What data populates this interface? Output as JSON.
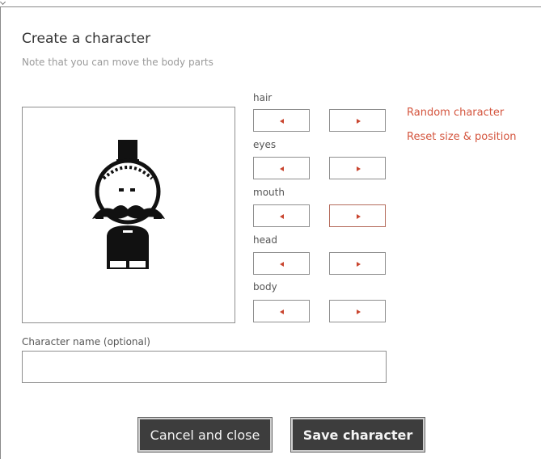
{
  "dialog": {
    "title": "Create a character",
    "subtitle": "Note that you can move the body parts"
  },
  "parts": [
    {
      "label": "hair",
      "prev_icon": "left-arrow-icon",
      "next_icon": "right-arrow-icon"
    },
    {
      "label": "eyes",
      "prev_icon": "left-arrow-icon",
      "next_icon": "right-arrow-icon"
    },
    {
      "label": "mouth",
      "prev_icon": "left-arrow-icon",
      "next_icon": "right-arrow-icon"
    },
    {
      "label": "head",
      "prev_icon": "left-arrow-icon",
      "next_icon": "right-arrow-icon"
    },
    {
      "label": "body",
      "prev_icon": "left-arrow-icon",
      "next_icon": "right-arrow-icon"
    }
  ],
  "links": {
    "random": "Random character",
    "reset": "Reset size & position"
  },
  "name_field": {
    "label": "Character name (optional)",
    "value": "",
    "placeholder": ""
  },
  "buttons": {
    "cancel": "Cancel and close",
    "save": "Save character"
  },
  "colors": {
    "accent_link": "#d4553e",
    "arrow": "#c9452f",
    "button_dark": "#3d3d3d",
    "highlight_border": "#b56c5c"
  }
}
